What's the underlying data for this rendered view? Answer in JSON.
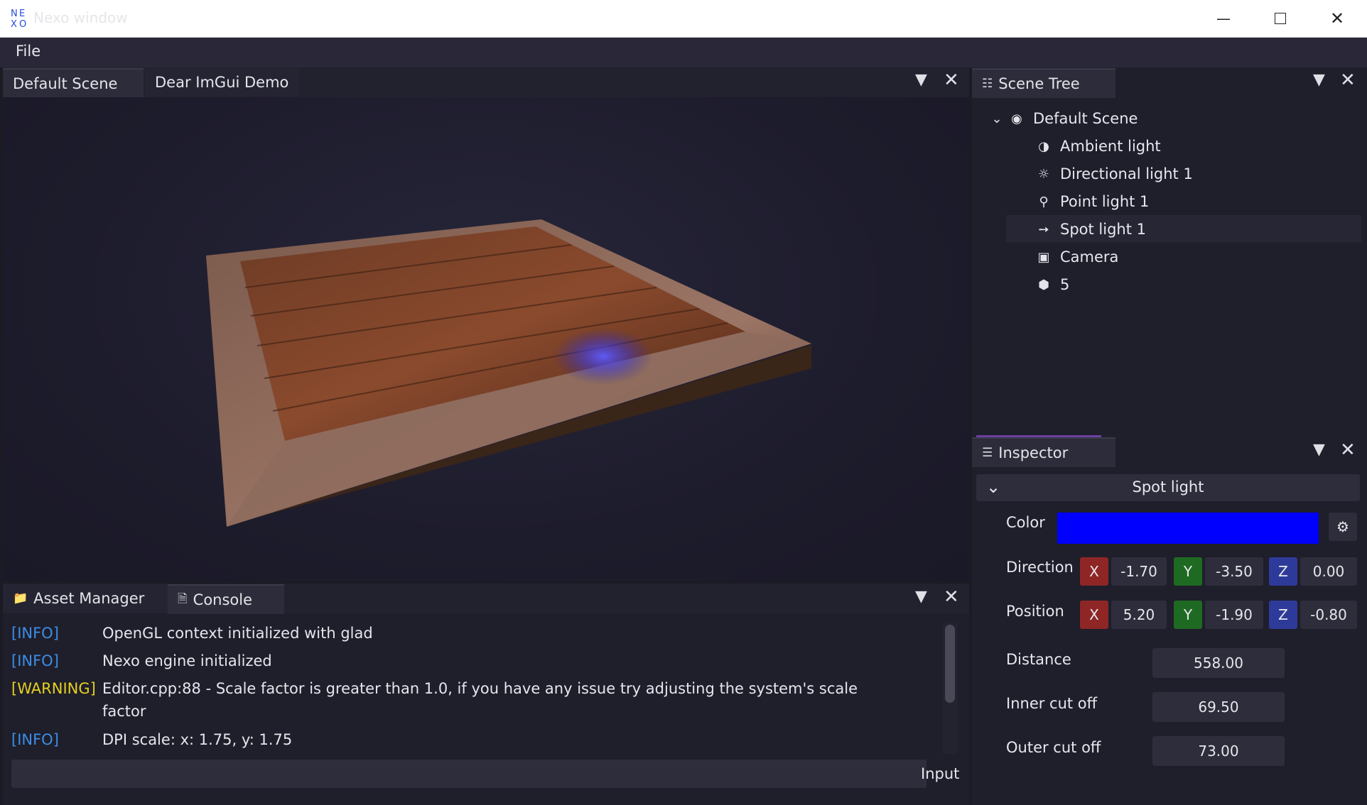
{
  "window": {
    "title": "Nexo window",
    "icon": "nexo-logo-icon",
    "minimize_icon": "minimize-icon",
    "maximize_icon": "maximize-icon",
    "close_icon": "close-icon"
  },
  "menu": {
    "items": [
      "File"
    ]
  },
  "viewport_panel": {
    "tabs": [
      "Default Scene",
      "Dear ImGui Demo"
    ]
  },
  "scene_tree": {
    "title": "Scene Tree",
    "root": "Default Scene",
    "items": [
      {
        "label": "Ambient light",
        "icon": "half-circle-icon"
      },
      {
        "label": "Directional light 1",
        "icon": "sun-icon"
      },
      {
        "label": "Point light 1",
        "icon": "lightbulb-icon"
      },
      {
        "label": "Spot light 1",
        "icon": "spotlight-icon"
      },
      {
        "label": "Camera",
        "icon": "camera-icon"
      },
      {
        "label": "5",
        "icon": "cube-icon"
      }
    ]
  },
  "inspector": {
    "title": "Inspector",
    "section": "Spot light",
    "color_label": "Color",
    "color_value": "#0000ff",
    "direction_label": "Direction",
    "direction": {
      "x": "-1.70",
      "y": "-3.50",
      "z": "0.00"
    },
    "position_label": "Position",
    "position": {
      "x": "5.20",
      "y": "-1.90",
      "z": "-0.80"
    },
    "axis": {
      "x": "X",
      "y": "Y",
      "z": "Z"
    },
    "distance_label": "Distance",
    "distance": "558.00",
    "inner_label": "Inner cut off",
    "inner": "69.50",
    "outer_label": "Outer cut off",
    "outer": "73.00"
  },
  "bottom_panel": {
    "tabs": [
      "Asset Manager",
      "Console"
    ],
    "logs": [
      {
        "level": "[INFO]",
        "msg": "OpenGL context initialized with glad"
      },
      {
        "level": "[INFO]",
        "msg": "Nexo engine initialized"
      },
      {
        "level": "[WARNING]",
        "msg": "Editor.cpp:88 - Scale factor is greater than 1.0, if you have any issue try adjusting the system's scale",
        "msg2": "factor"
      },
      {
        "level": "[INFO]",
        "msg": "DPI scale: x: 1.75, y: 1.75"
      }
    ],
    "input_label": "Input",
    "input_value": ""
  }
}
